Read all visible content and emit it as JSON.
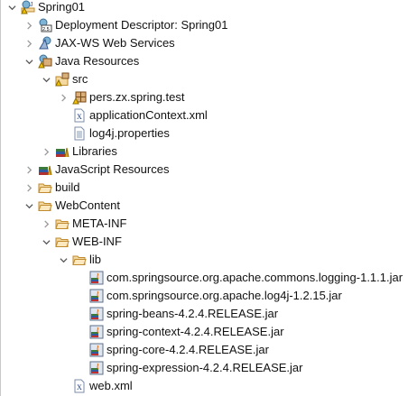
{
  "tree": [
    {
      "label": "Spring01",
      "level": 0,
      "state": "open",
      "icon": "web-project-icon"
    },
    {
      "label": "Deployment Descriptor: Spring01",
      "level": 1,
      "state": "closed",
      "icon": "deployment-descriptor-icon"
    },
    {
      "label": "JAX-WS Web Services",
      "level": 1,
      "state": "closed",
      "icon": "web-services-icon"
    },
    {
      "label": "Java Resources",
      "level": 1,
      "state": "open",
      "icon": "java-resources-icon"
    },
    {
      "label": "src",
      "level": 2,
      "state": "open",
      "icon": "source-folder-icon"
    },
    {
      "label": "pers.zx.spring.test",
      "level": 3,
      "state": "closed",
      "icon": "package-icon"
    },
    {
      "label": "applicationContext.xml",
      "level": 3,
      "state": "none",
      "icon": "xml-file-icon"
    },
    {
      "label": "log4j.properties",
      "level": 3,
      "state": "none",
      "icon": "text-file-icon"
    },
    {
      "label": "Libraries",
      "level": 2,
      "state": "closed",
      "icon": "libraries-icon"
    },
    {
      "label": "JavaScript Resources",
      "level": 1,
      "state": "closed",
      "icon": "libraries-icon"
    },
    {
      "label": "build",
      "level": 1,
      "state": "closed",
      "icon": "folder-icon"
    },
    {
      "label": "WebContent",
      "level": 1,
      "state": "open",
      "icon": "folder-icon"
    },
    {
      "label": "META-INF",
      "level": 2,
      "state": "closed",
      "icon": "folder-icon"
    },
    {
      "label": "WEB-INF",
      "level": 2,
      "state": "open",
      "icon": "folder-icon"
    },
    {
      "label": "lib",
      "level": 3,
      "state": "open",
      "icon": "folder-icon"
    },
    {
      "label": "com.springsource.org.apache.commons.logging-1.1.1.jar",
      "level": 4,
      "state": "none",
      "icon": "jar-icon"
    },
    {
      "label": "com.springsource.org.apache.log4j-1.2.15.jar",
      "level": 4,
      "state": "none",
      "icon": "jar-icon"
    },
    {
      "label": "spring-beans-4.2.4.RELEASE.jar",
      "level": 4,
      "state": "none",
      "icon": "jar-icon"
    },
    {
      "label": "spring-context-4.2.4.RELEASE.jar",
      "level": 4,
      "state": "none",
      "icon": "jar-icon"
    },
    {
      "label": "spring-core-4.2.4.RELEASE.jar",
      "level": 4,
      "state": "none",
      "icon": "jar-icon"
    },
    {
      "label": "spring-expression-4.2.4.RELEASE.jar",
      "level": 4,
      "state": "none",
      "icon": "jar-icon"
    },
    {
      "label": "web.xml",
      "level": 3,
      "state": "none",
      "icon": "xml-file-icon"
    }
  ]
}
